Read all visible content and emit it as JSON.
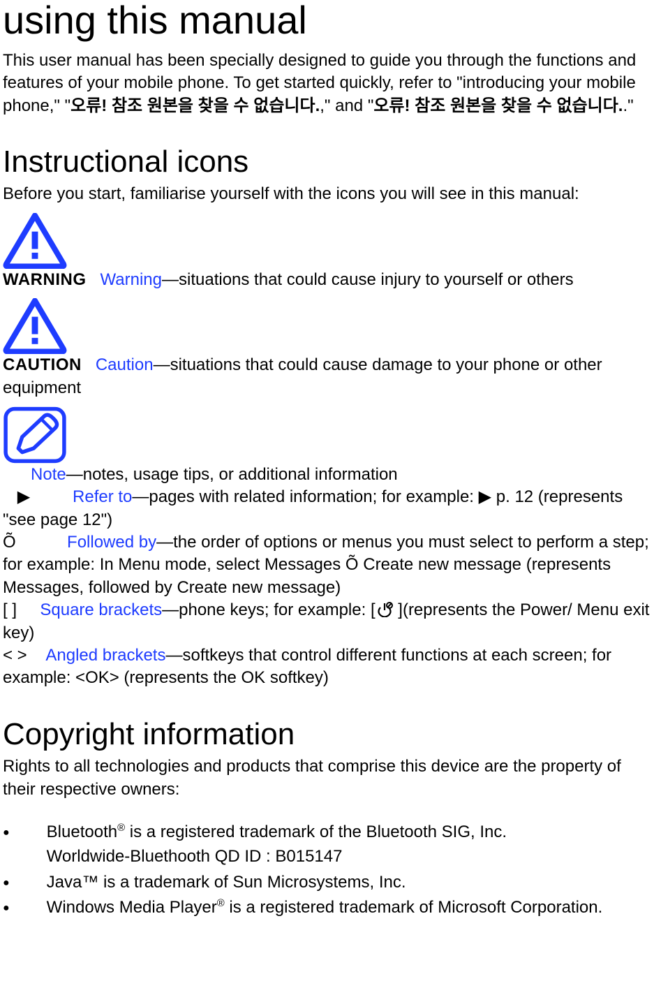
{
  "title1": "using this manual",
  "intro_html_parts": {
    "p1a": "This user manual has been specially designed to guide you through the functions and features of your mobile phone. To get started quickly, refer to \"introducing your mobile phone,\" \"",
    "p1b_bold": "오류!  참조  원본을  찾을  수  없습니다.",
    "p1c": ",\" and \"",
    "p1d_bold": "오류!  참조  원본을  찾을  수  없습니다.",
    "p1e": ".\""
  },
  "title2": "Instructional icons",
  "instr_lead": "Before you start, familiarise yourself with the icons you will see in this manual:",
  "warning": {
    "label": "WARNING",
    "term": "Warning",
    "desc": "—situations that could cause injury to yourself or others"
  },
  "caution": {
    "label": "CAUTION",
    "term": "Caution",
    "desc": "—situations that could cause damage to your phone or other equipment"
  },
  "note": {
    "term": "Note",
    "desc": "—notes, usage tips, or additional information"
  },
  "refer": {
    "symbol": "▶",
    "term": "Refer to",
    "desc": "—pages with related information; for example: ▶ p. 12 (represents \"see page 12\")"
  },
  "followed": {
    "symbol": "Õ",
    "term": "Followed by",
    "desc_a": "—the order of options or menus you must select to perform a step; for example: In Menu mode, select Messages ",
    "desc_mid": "Õ",
    "desc_b": " Create new message (represents Messages, followed by Create new message)"
  },
  "square": {
    "symbol": "[    ]",
    "term": "Square brackets",
    "desc_a": "—phone keys; for example: [",
    "desc_b": " ](represents the Power/ Menu exit key)"
  },
  "angled": {
    "symbol": "<    >",
    "term": "Angled brackets",
    "desc": "—softkeys that control different functions at each screen; for example: <OK> (represents the OK softkey)"
  },
  "title3": "Copyright information",
  "copyright_lead": "Rights to all technologies and products that comprise this device are the property of their respective owners:",
  "bullets": {
    "b1_a": "Bluetooth",
    "b1_sup": "®",
    "b1_b": " is a registered trademark of the Bluetooth SIG, Inc.",
    "b1_sub": "Worldwide-Bluethooth QD ID : B015147",
    "b2": "Java™ is a trademark of Sun Microsystems, Inc.",
    "b3_a": "Windows Media Player",
    "b3_sup": "®",
    "b3_b": " is a registered trademark of Microsoft Corporation."
  }
}
